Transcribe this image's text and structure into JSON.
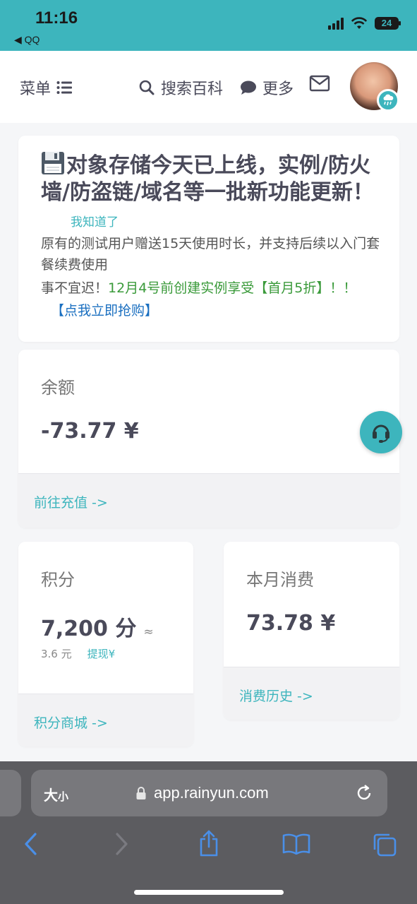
{
  "status": {
    "time": "11:16",
    "back_app": "◀ QQ",
    "battery": "24"
  },
  "header": {
    "menu": "菜单",
    "search": "搜索百科",
    "more": "更多"
  },
  "notice": {
    "title": "对象存储今天已上线，实例/防火墙/防盗链/域名等一批新功能更新！",
    "got_it": "我知道了",
    "body": "原有的测试用户赠送15天使用时长，并支持后续以入门套餐续费使用",
    "line2_prefix": "事不宜迟！",
    "line2_green": "12月4号前创建实例享受【首月5折】！！",
    "line2_link": "【点我立即抢购】"
  },
  "balance": {
    "label": "余额",
    "amount": "-73.77 ¥",
    "link": "前往充值 ->"
  },
  "points": {
    "label": "积分",
    "amount": "7,200 分",
    "approx": "≈",
    "yuan": "3.6 元",
    "withdraw": "提现¥",
    "link": "积分商城 ->"
  },
  "monthly": {
    "label": "本月消费",
    "amount": "73.78 ¥",
    "link": "消费历史 ->"
  },
  "browser": {
    "text_size_big": "大",
    "text_size_small": "小",
    "url": "app.rainyun.com"
  },
  "colors": {
    "accent": "#3db5bd",
    "green_text": "#3a9a3a",
    "blue_link": "#1a6fc0"
  }
}
